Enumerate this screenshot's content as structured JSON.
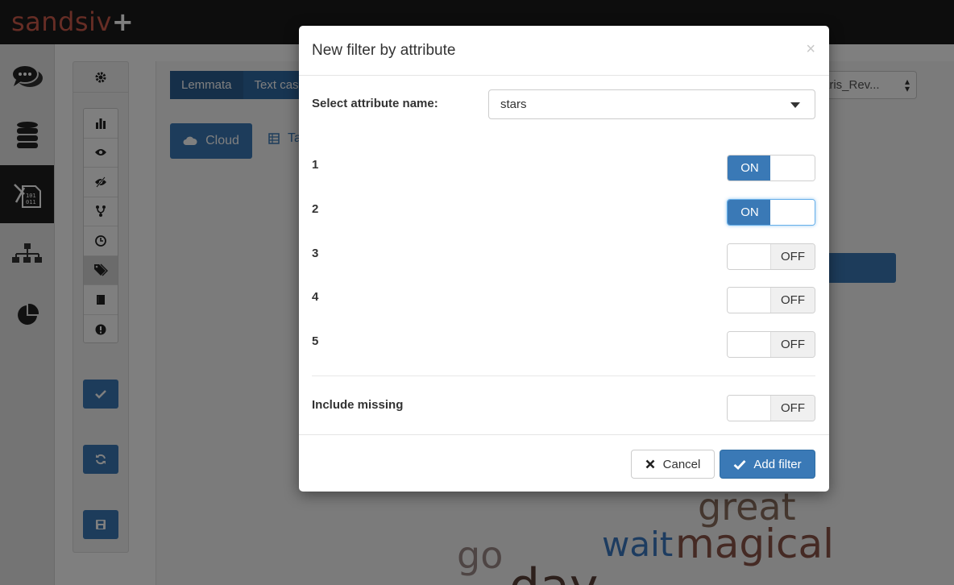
{
  "app": {
    "brand": "sandsiv",
    "brand_plus": "+"
  },
  "workspace": {
    "tabs": [
      {
        "label": "Lemmata"
      },
      {
        "label": "Text cas"
      }
    ],
    "dataset_select": {
      "value": "aris_Rev..."
    },
    "view_buttons": {
      "cloud_label": "Cloud",
      "table_label": "Ta"
    },
    "word_cloud": [
      {
        "word": "great",
        "color": "#8b6f5f"
      },
      {
        "word": "wait",
        "color": "#3b78c0"
      },
      {
        "word": "magical",
        "color": "#8a5548"
      },
      {
        "word": "go",
        "color": "#9c8a88"
      },
      {
        "word": "day",
        "color": "#5a4038"
      }
    ]
  },
  "modal": {
    "title": "New filter by attribute",
    "close_symbol": "×",
    "attribute_label": "Select attribute name:",
    "attribute_value": "stars",
    "values": [
      {
        "label": "1",
        "state": "ON"
      },
      {
        "label": "2",
        "state": "ON"
      },
      {
        "label": "3",
        "state": "OFF"
      },
      {
        "label": "4",
        "state": "OFF"
      },
      {
        "label": "5",
        "state": "OFF"
      }
    ],
    "include_missing": {
      "label": "Include missing",
      "state": "OFF"
    },
    "cancel_label": "Cancel",
    "add_label": "Add filter"
  },
  "colors": {
    "accent": "#3a79b6",
    "brand": "#cc5a4b",
    "topbar": "#1a1a1a"
  },
  "icons": [
    "chat-icon",
    "database-icon",
    "text-analysis-icon",
    "hierarchy-icon",
    "pie-chart-icon",
    "gear-icon",
    "bar-chart-icon",
    "eye-icon",
    "eye-slash-icon",
    "fork-icon",
    "clock-icon",
    "tags-icon",
    "book-icon",
    "alert-icon",
    "check-icon",
    "refresh-icon",
    "save-icon",
    "cloud-icon",
    "table-icon",
    "close-icon",
    "caret-down-icon"
  ]
}
